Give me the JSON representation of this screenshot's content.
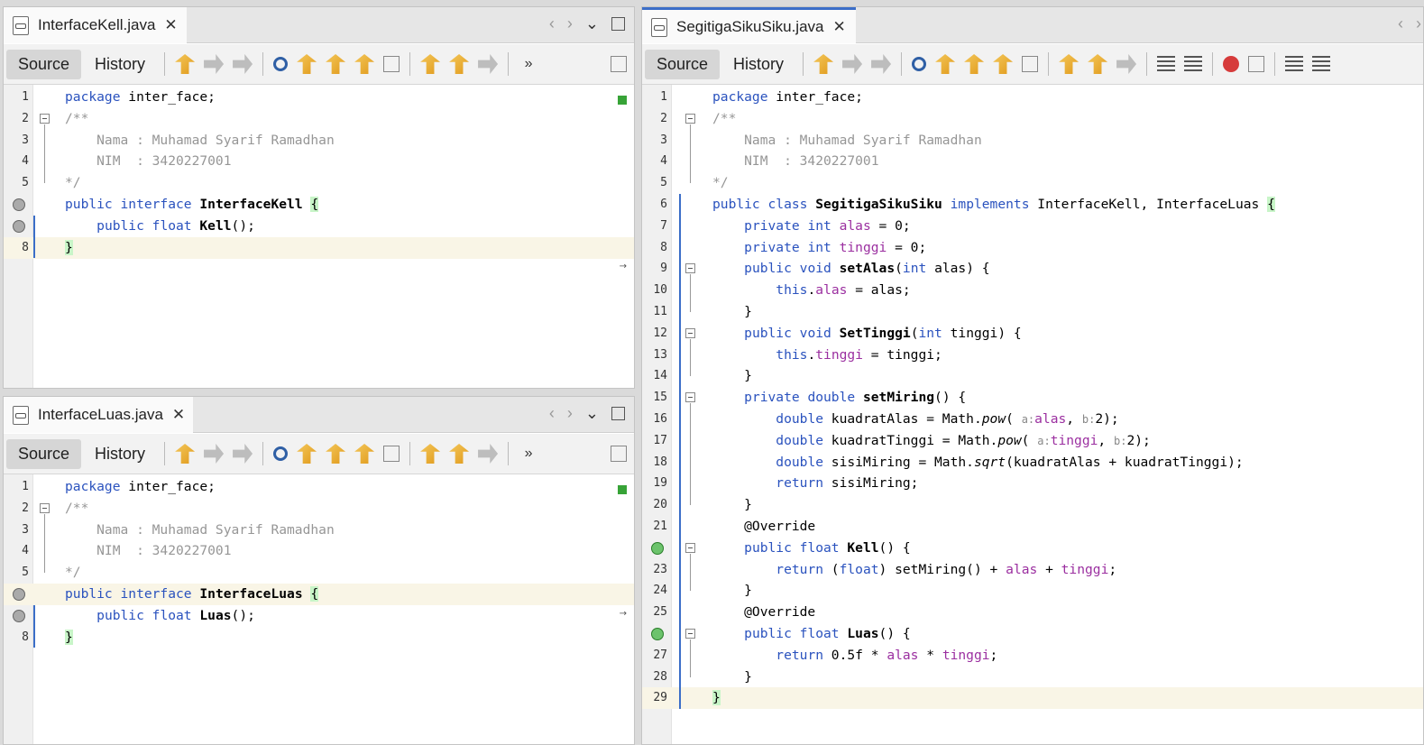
{
  "toolbar_labels": {
    "source": "Source",
    "history": "History"
  },
  "panes": {
    "kell": {
      "tab": "InterfaceKell.java",
      "lines": [
        {
          "n": "1",
          "html": "<span class=\"kw\">package</span> inter_face;"
        },
        {
          "n": "2",
          "html": "<span class=\"cm\">/**</span>"
        },
        {
          "n": "3",
          "html": "<span class=\"cm\">    Nama : Muhamad Syarif Ramadhan</span>"
        },
        {
          "n": "4",
          "html": "<span class=\"cm\">    NIM  : 3420227001</span>"
        },
        {
          "n": "5",
          "html": "<span class=\"cm\">*/</span>"
        },
        {
          "n": "",
          "html": "<span class=\"kw\">public interface</span> <span class=\"mth\">InterfaceKell</span> <span class=\"br\">{</span>"
        },
        {
          "n": "",
          "html": "    <span class=\"kw\">public float</span> <span class=\"mth\">Kell</span>();"
        },
        {
          "n": "8",
          "html": "<span class=\"br\">}</span>"
        }
      ]
    },
    "luas": {
      "tab": "InterfaceLuas.java",
      "lines": [
        {
          "n": "1",
          "html": "<span class=\"kw\">package</span> inter_face;"
        },
        {
          "n": "2",
          "html": "<span class=\"cm\">/**</span>"
        },
        {
          "n": "3",
          "html": "<span class=\"cm\">    Nama : Muhamad Syarif Ramadhan</span>"
        },
        {
          "n": "4",
          "html": "<span class=\"cm\">    NIM  : 3420227001</span>"
        },
        {
          "n": "5",
          "html": "<span class=\"cm\">*/</span>"
        },
        {
          "n": "",
          "html": "<span class=\"kw\">public interface</span> <span class=\"mth\">InterfaceLuas</span> <span class=\"br\">{</span>"
        },
        {
          "n": "",
          "html": "    <span class=\"kw\">public float</span> <span class=\"mth\">Luas</span>();"
        },
        {
          "n": "8",
          "html": "<span class=\"br\">}</span>"
        }
      ]
    },
    "segitiga": {
      "tab": "SegitigaSikuSiku.java",
      "lines": [
        {
          "n": "1",
          "html": "<span class=\"kw\">package</span> inter_face;"
        },
        {
          "n": "2",
          "html": "<span class=\"cm\">/**</span>"
        },
        {
          "n": "3",
          "html": "<span class=\"cm\">    Nama : Muhamad Syarif Ramadhan</span>"
        },
        {
          "n": "4",
          "html": "<span class=\"cm\">    NIM  : 3420227001</span>"
        },
        {
          "n": "5",
          "html": "<span class=\"cm\">*/</span>"
        },
        {
          "n": "6",
          "html": "<span class=\"kw\">public class</span> <span class=\"mth\">SegitigaSikuSiku</span> <span class=\"kw\">implements</span> InterfaceKell, InterfaceLuas <span class=\"br\">{</span>"
        },
        {
          "n": "7",
          "html": "    <span class=\"kw\">private int</span> <span class=\"fld\">alas</span> = 0;"
        },
        {
          "n": "8",
          "html": "    <span class=\"kw\">private int</span> <span class=\"fld\">tinggi</span> = 0;"
        },
        {
          "n": "9",
          "html": "    <span class=\"kw\">public void</span> <span class=\"mth\">setAlas</span>(<span class=\"kw\">int</span> alas) {"
        },
        {
          "n": "10",
          "html": "        <span class=\"kw\">this</span>.<span class=\"fld\">alas</span> = alas;"
        },
        {
          "n": "11",
          "html": "    }"
        },
        {
          "n": "12",
          "html": "    <span class=\"kw\">public void</span> <span class=\"mth\">SetTinggi</span>(<span class=\"kw\">int</span> tinggi) {"
        },
        {
          "n": "13",
          "html": "        <span class=\"kw\">this</span>.<span class=\"fld\">tinggi</span> = tinggi;"
        },
        {
          "n": "14",
          "html": "    }"
        },
        {
          "n": "15",
          "html": "    <span class=\"kw\">private double</span> <span class=\"mth\">setMiring</span>() {"
        },
        {
          "n": "16",
          "html": "        <span class=\"kw\">double</span> kuadratAlas = Math.<span class=\"it\">pow</span>( <span class=\"hint\">a:</span><span class=\"fld\">alas</span>, <span class=\"hint\">b:</span>2);"
        },
        {
          "n": "17",
          "html": "        <span class=\"kw\">double</span> kuadratTinggi = Math.<span class=\"it\">pow</span>( <span class=\"hint\">a:</span><span class=\"fld\">tinggi</span>, <span class=\"hint\">b:</span>2);"
        },
        {
          "n": "18",
          "html": "        <span class=\"kw\">double</span> sisiMiring = Math.<span class=\"it\">sqrt</span>(kuadratAlas + kuadratTinggi);"
        },
        {
          "n": "19",
          "html": "        <span class=\"kw\">return</span> sisiMiring;"
        },
        {
          "n": "20",
          "html": "    }"
        },
        {
          "n": "21",
          "html": "    @Override"
        },
        {
          "n": "",
          "html": "    <span class=\"kw\">public float</span> <span class=\"mth\">Kell</span>() {"
        },
        {
          "n": "23",
          "html": "        <span class=\"kw\">return</span> (<span class=\"kw\">float</span>) setMiring() + <span class=\"fld\">alas</span> + <span class=\"fld\">tinggi</span>;"
        },
        {
          "n": "24",
          "html": "    }"
        },
        {
          "n": "25",
          "html": "    @Override"
        },
        {
          "n": "",
          "html": "    <span class=\"kw\">public float</span> <span class=\"mth\">Luas</span>() {"
        },
        {
          "n": "27",
          "html": "        <span class=\"kw\">return</span> 0.5f * <span class=\"fld\">alas</span> * <span class=\"fld\">tinggi</span>;"
        },
        {
          "n": "28",
          "html": "    }"
        },
        {
          "n": "29",
          "html": "<span class=\"br\">}</span>"
        }
      ]
    }
  }
}
